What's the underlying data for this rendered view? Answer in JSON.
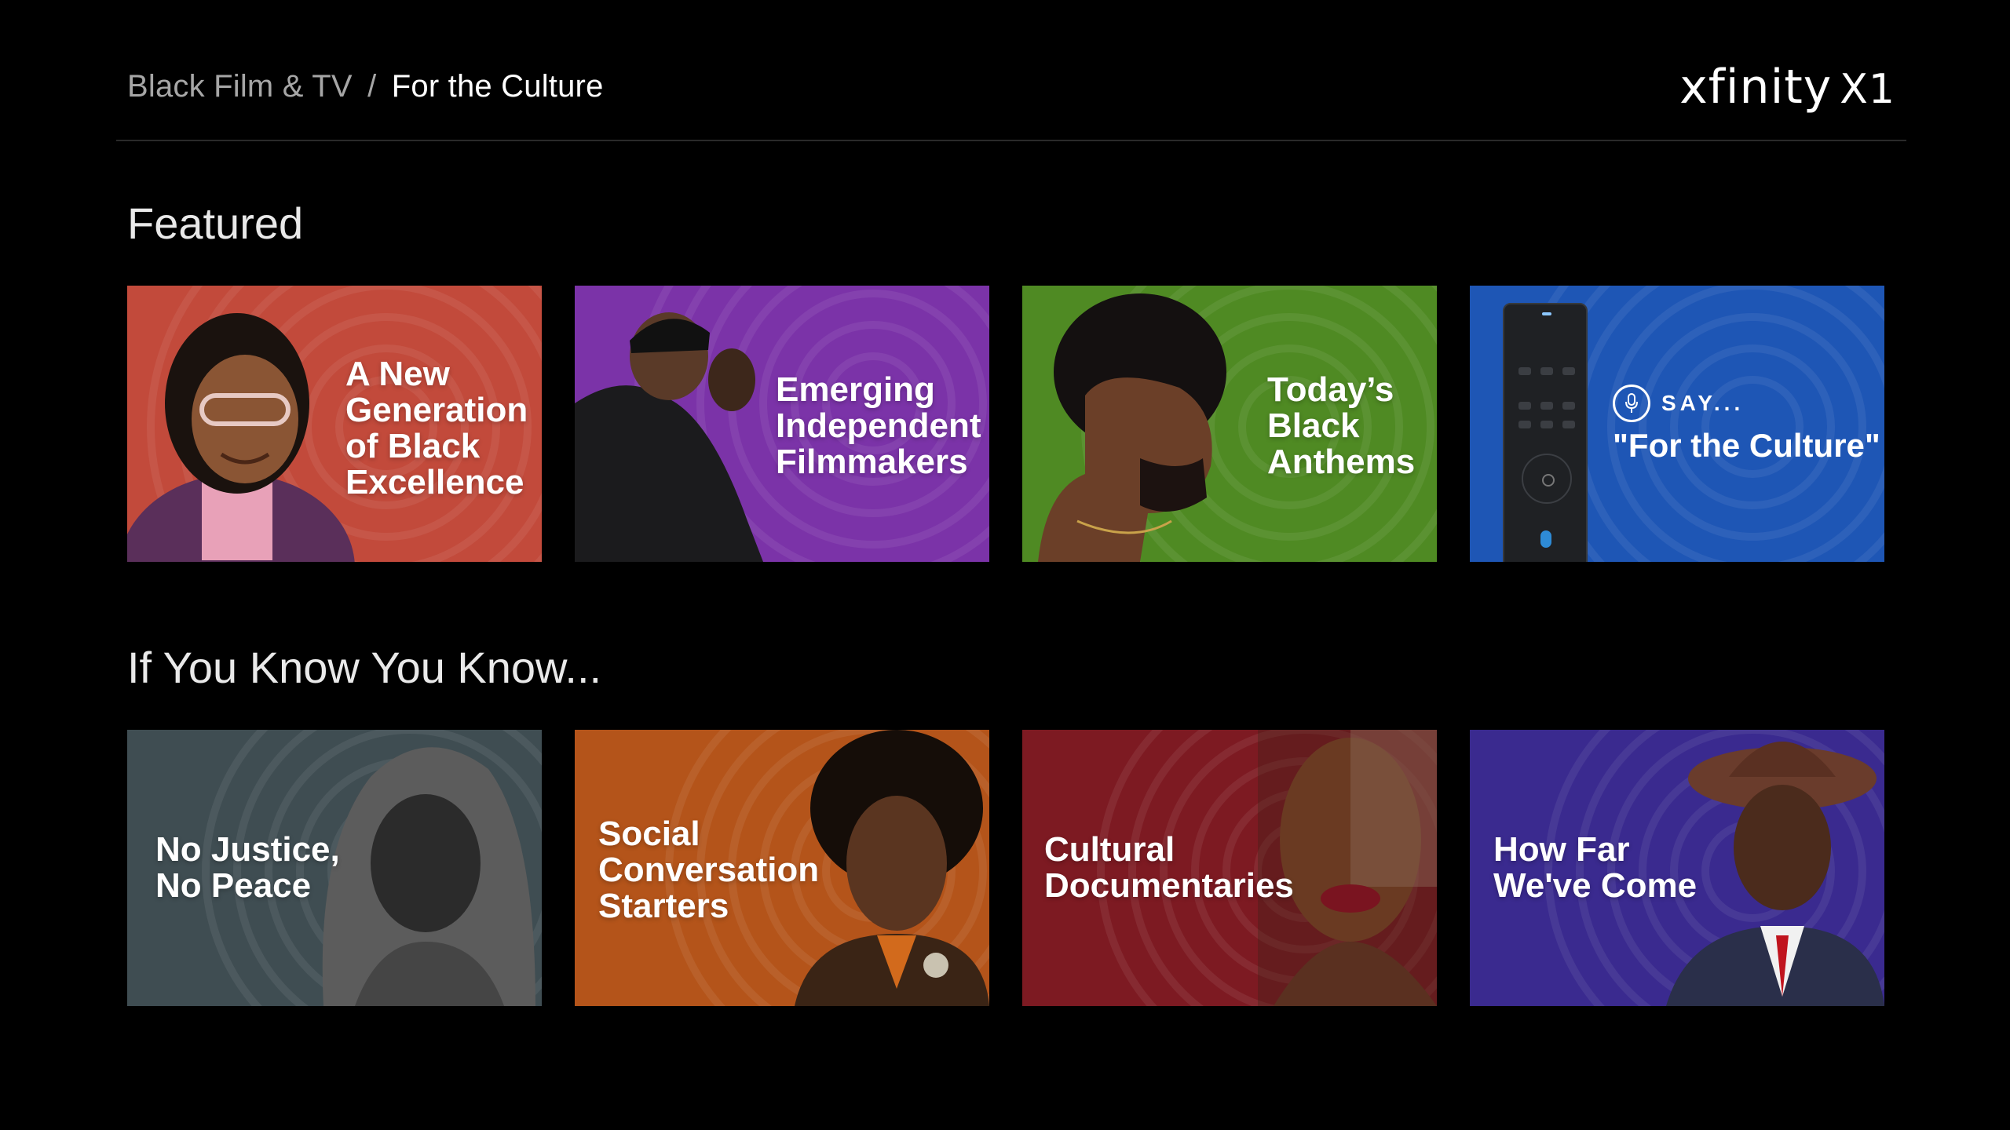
{
  "header": {
    "breadcrumb_parent": "Black Film & TV",
    "breadcrumb_separator": "/",
    "breadcrumb_current": "For the Culture",
    "logo_wordmark": "xfinity",
    "logo_suffix": "X1"
  },
  "sections": [
    {
      "title": "Featured",
      "tiles": [
        {
          "label": "A New\nGeneration\nof Black\nExcellence",
          "color": "#c24a3b"
        },
        {
          "label": "Emerging\nIndependent\nFilmmakers",
          "color": "#7b33a8"
        },
        {
          "label": "Today’s\nBlack\nAnthems",
          "color": "#4f8a23"
        },
        {
          "say_label": "SAY...",
          "say_phrase": "\"For the Culture\"",
          "color": "#1e56b5"
        }
      ]
    },
    {
      "title": "If You Know You Know...",
      "tiles": [
        {
          "label": "No Justice,\nNo Peace",
          "color": "#3f4d52"
        },
        {
          "label": "Social\nConversation\nStarters",
          "color": "#b4541a"
        },
        {
          "label": "Cultural\nDocumentaries",
          "color": "#7d1a22"
        },
        {
          "label": "How Far\nWe've Come",
          "color": "#3a2a8f"
        }
      ]
    }
  ],
  "icons": {
    "voice": "microphone-icon"
  }
}
